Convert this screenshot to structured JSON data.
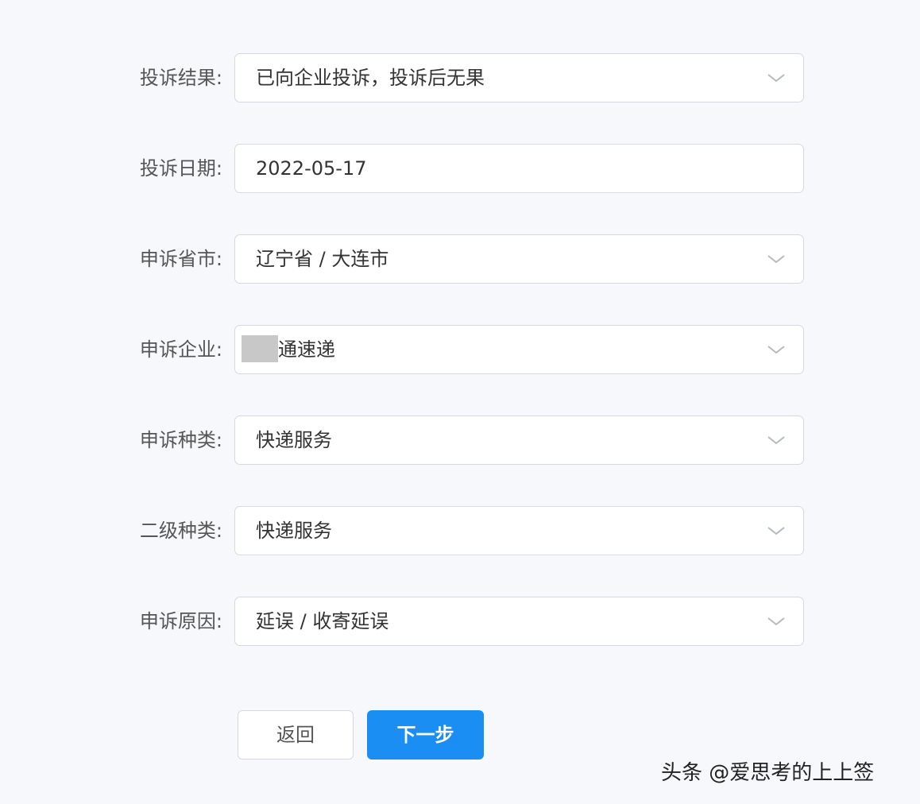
{
  "form": {
    "rows": [
      {
        "label": "投诉结果:",
        "value": "已向企业投诉，投诉后无果",
        "type": "select"
      },
      {
        "label": "投诉日期:",
        "value": "2022-05-17",
        "type": "date"
      },
      {
        "label": "申诉省市:",
        "value": "辽宁省 / 大连市",
        "type": "select"
      },
      {
        "label": "申诉企业:",
        "value": "通速递",
        "type": "select",
        "redacted_prefix": true
      },
      {
        "label": "申诉种类:",
        "value": "快递服务",
        "type": "select"
      },
      {
        "label": "二级种类:",
        "value": "快递服务",
        "type": "select"
      },
      {
        "label": "申诉原因:",
        "value": "延误 / 收寄延误",
        "type": "select"
      }
    ]
  },
  "buttons": {
    "back_label": "返回",
    "next_label": "下一步"
  },
  "watermark": "头条 @爱思考的上上签",
  "icons": {
    "select_arrow": "chevron-down-icon"
  },
  "colors": {
    "primary": "#1a8ef2",
    "border": "#d6d9e2",
    "background": "#f7f8fb",
    "redaction": "#c8c8c8"
  }
}
